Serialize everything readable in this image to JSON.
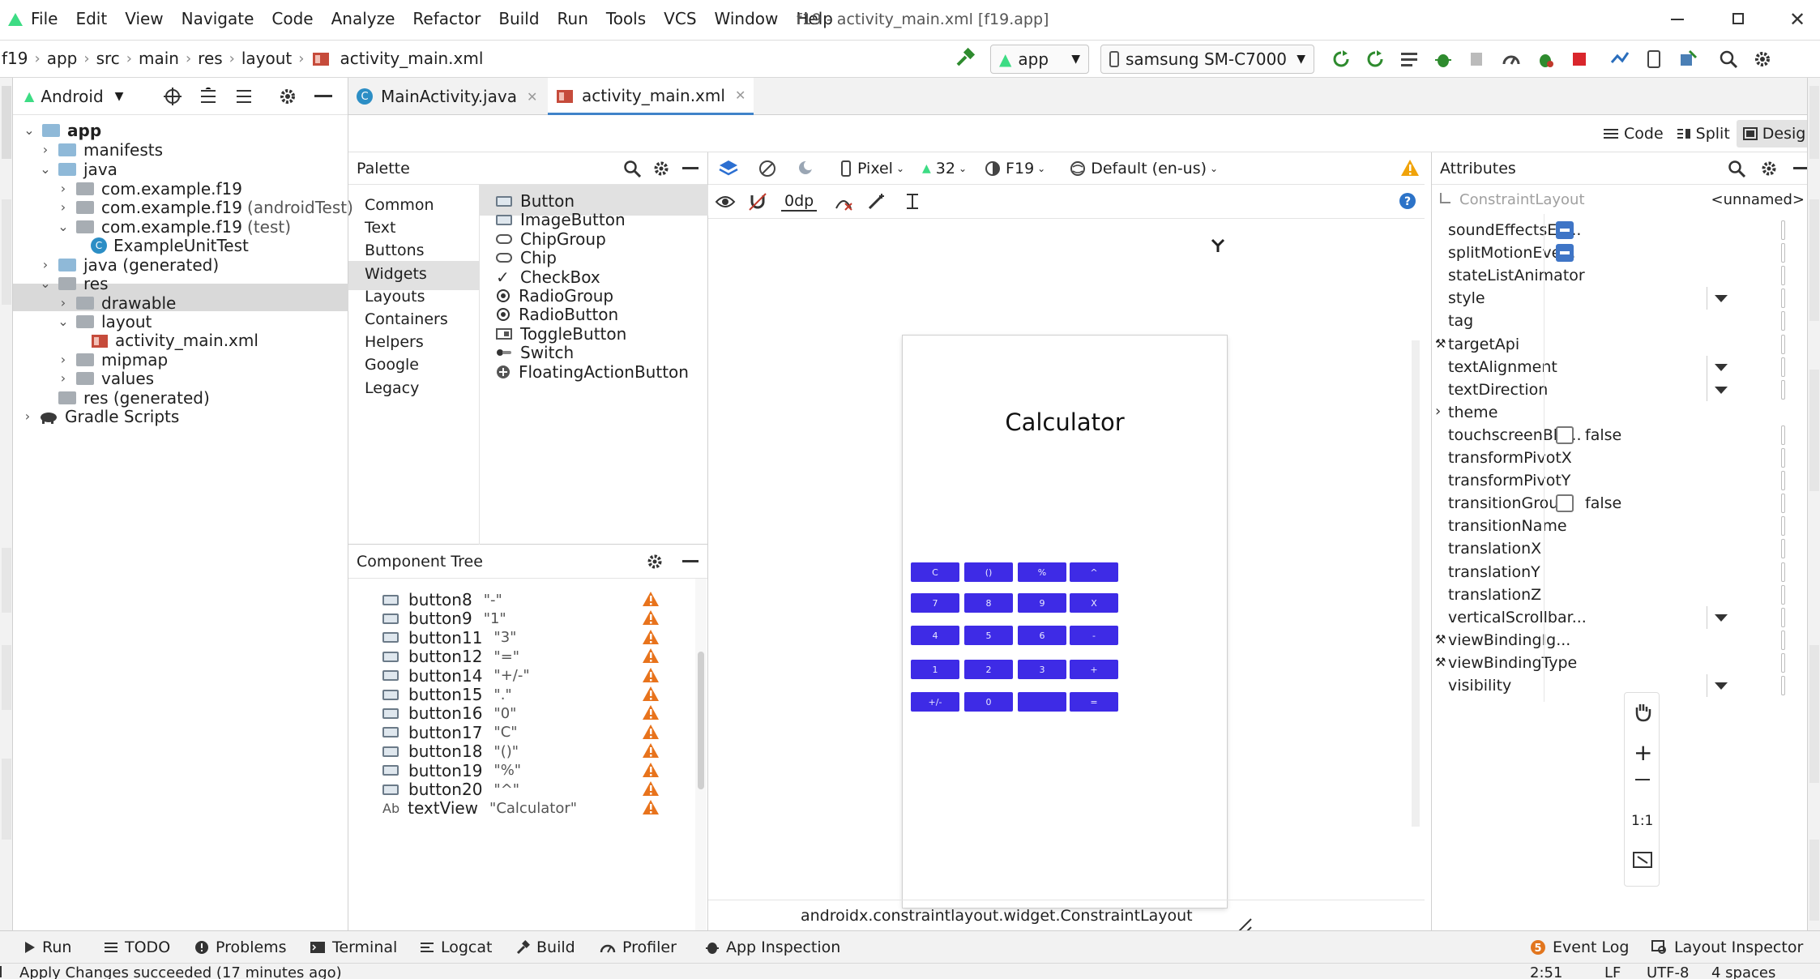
{
  "menubar": {
    "items": [
      "File",
      "Edit",
      "View",
      "Navigate",
      "Code",
      "Analyze",
      "Refactor",
      "Build",
      "Run",
      "Tools",
      "VCS",
      "Window",
      "Help"
    ],
    "title": "f19 - activity_main.xml [f19.app]"
  },
  "navbar": {
    "breadcrumbs": [
      "f19",
      "app",
      "src",
      "main",
      "res",
      "layout",
      "activity_main.xml"
    ],
    "run_config": "app",
    "device": "samsung SM-C7000"
  },
  "project": {
    "view_mode": "Android",
    "tree": [
      {
        "label": "app",
        "bold": true
      },
      {
        "label": "manifests"
      },
      {
        "label": "java"
      },
      {
        "label": "com.example.f19"
      },
      {
        "label": "com.example.f19",
        "suffix": "(androidTest)"
      },
      {
        "label": "com.example.f19",
        "suffix": "(test)"
      },
      {
        "label": "ExampleUnitTest"
      },
      {
        "label": "java (generated)"
      },
      {
        "label": "res"
      },
      {
        "label": "drawable"
      },
      {
        "label": "layout"
      },
      {
        "label": "activity_main.xml"
      },
      {
        "label": "mipmap"
      },
      {
        "label": "values"
      },
      {
        "label": "res (generated)"
      },
      {
        "label": "Gradle Scripts"
      }
    ]
  },
  "tabs": [
    {
      "label": "MainActivity.java"
    },
    {
      "label": "activity_main.xml"
    }
  ],
  "view_modes": {
    "code": "Code",
    "split": "Split",
    "design": "Design"
  },
  "palette": {
    "title": "Palette",
    "categories": [
      "Common",
      "Text",
      "Buttons",
      "Widgets",
      "Layouts",
      "Containers",
      "Helpers",
      "Google",
      "Legacy"
    ],
    "selected_category": "Buttons",
    "items": [
      "Button",
      "ImageButton",
      "ChipGroup",
      "Chip",
      "CheckBox",
      "RadioGroup",
      "RadioButton",
      "ToggleButton",
      "Switch",
      "FloatingActionButton"
    ]
  },
  "design_toolbar": {
    "device": "Pixel",
    "api": "32",
    "theme": "F19",
    "locale": "Default (en-us)",
    "margin": "0dp"
  },
  "component_tree": {
    "title": "Component Tree",
    "rows": [
      {
        "id": "button8",
        "text": "\"-\""
      },
      {
        "id": "button9",
        "text": "\"1\""
      },
      {
        "id": "button11",
        "text": "\"3\""
      },
      {
        "id": "button12",
        "text": "\"=\""
      },
      {
        "id": "button14",
        "text": "\"+/-\""
      },
      {
        "id": "button15",
        "text": "\".\""
      },
      {
        "id": "button16",
        "text": "\"0\""
      },
      {
        "id": "button17",
        "text": "\"C\""
      },
      {
        "id": "button18",
        "text": "\"()\""
      },
      {
        "id": "button19",
        "text": "\"%\""
      },
      {
        "id": "button20",
        "text": "\"^\""
      },
      {
        "id": "textView",
        "text": "\"Calculator\"",
        "prefix": "Ab"
      }
    ]
  },
  "preview": {
    "title": "Calculator",
    "button_color": "#3e2be6",
    "buttons": [
      [
        "C",
        "()",
        "%",
        "^"
      ],
      [
        "7",
        "8",
        "9",
        "X"
      ],
      [
        "4",
        "5",
        "6",
        "-"
      ],
      [
        "1",
        "2",
        "3",
        "+"
      ],
      [
        "+/-",
        "0",
        "",
        "="
      ]
    ]
  },
  "zoom_controls": {
    "fit_label": "1:1"
  },
  "layout_path": "androidx.constraintlayout.widget.ConstraintLayout",
  "attributes": {
    "title": "Attributes",
    "component": "ConstraintLayout",
    "id_value": "<unnamed>",
    "rows": [
      {
        "name": "soundEffectsEn...",
        "kind": "check-on"
      },
      {
        "name": "splitMotionEve...",
        "kind": "check-on"
      },
      {
        "name": "stateListAnimator",
        "kind": "text"
      },
      {
        "name": "style",
        "kind": "dropdown"
      },
      {
        "name": "tag",
        "kind": "text"
      },
      {
        "name": "targetApi",
        "kind": "text",
        "wrench": true
      },
      {
        "name": "textAlignment",
        "kind": "dropdown"
      },
      {
        "name": "textDirection",
        "kind": "dropdown"
      },
      {
        "name": "theme",
        "kind": "group"
      },
      {
        "name": "touchscreenBlo...",
        "kind": "check-off",
        "value": "false"
      },
      {
        "name": "transformPivotX",
        "kind": "text"
      },
      {
        "name": "transformPivotY",
        "kind": "text"
      },
      {
        "name": "transitionGroup",
        "kind": "check-off",
        "value": "false"
      },
      {
        "name": "transitionName",
        "kind": "text"
      },
      {
        "name": "translationX",
        "kind": "text"
      },
      {
        "name": "translationY",
        "kind": "text"
      },
      {
        "name": "translationZ",
        "kind": "text"
      },
      {
        "name": "verticalScrollbar...",
        "kind": "dropdown"
      },
      {
        "name": "viewBindingIg...",
        "kind": "text",
        "wrench": true
      },
      {
        "name": "viewBindingType",
        "kind": "text",
        "wrench": true
      },
      {
        "name": "visibility",
        "kind": "dropdown"
      }
    ]
  },
  "bottom_tools": {
    "left": [
      "Run",
      "TODO",
      "Problems",
      "Terminal",
      "Logcat",
      "Build",
      "Profiler",
      "App Inspection"
    ],
    "right": [
      "Event Log",
      "Layout Inspector"
    ]
  },
  "status": {
    "message": "Apply Changes succeeded (17 minutes ago)",
    "position": "2:51",
    "line_sep": "LF",
    "encoding": "UTF-8",
    "indent": "4 spaces"
  }
}
